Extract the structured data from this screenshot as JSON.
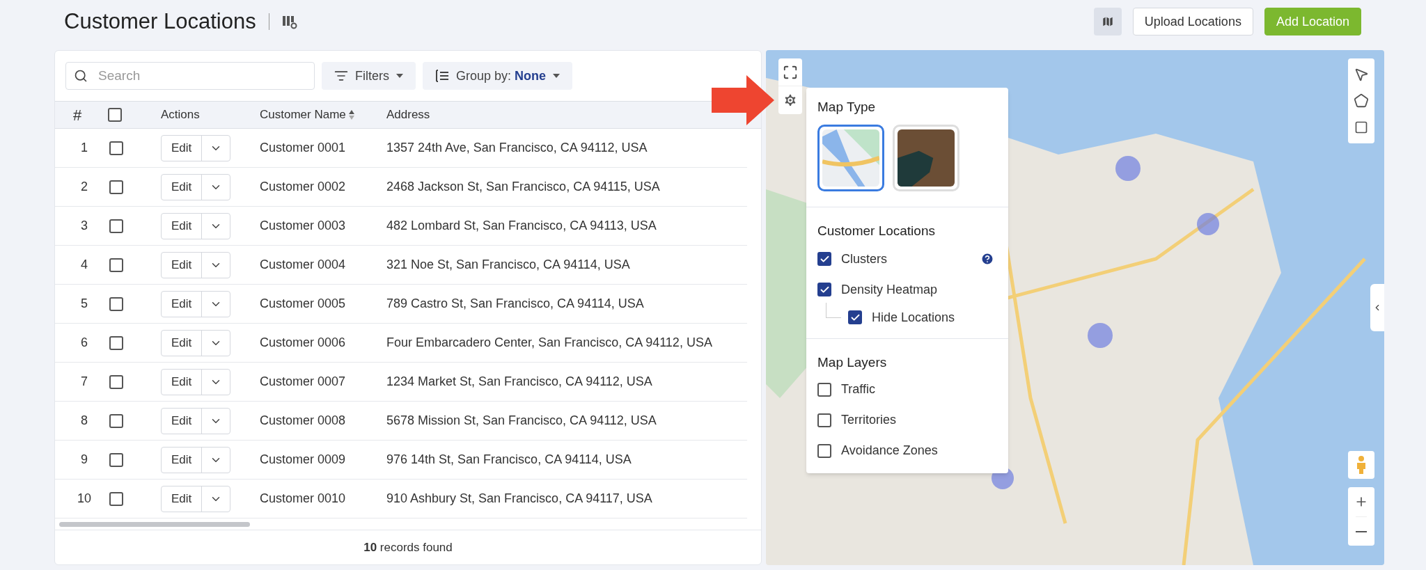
{
  "header": {
    "title": "Customer Locations",
    "buttons": [
      {
        "kind": "secondary",
        "label": "Upload Locations"
      },
      {
        "kind": "primary",
        "label": "Add Location"
      }
    ]
  },
  "toolbar": {
    "search": {
      "placeholder": "Search"
    },
    "filters": "Filters",
    "group_by": {
      "label": "Group by:",
      "value": "None"
    }
  },
  "table": {
    "columns": [
      "#",
      "Actions",
      "Customer Name",
      "Address"
    ],
    "select_all": {
      "checked": false
    },
    "rows": [
      {
        "index": "1",
        "checked": false,
        "action": "Edit",
        "name": "Customer 0001",
        "address": "1357 24th Ave, San Francisco, CA 94112, USA"
      },
      {
        "index": "2",
        "checked": false,
        "action": "Edit",
        "name": "Customer 0002",
        "address": "2468 Jackson St, San Francisco, CA 94115, USA"
      },
      {
        "index": "3",
        "checked": false,
        "action": "Edit",
        "name": "Customer 0003",
        "address": "482 Lombard St, San Francisco, CA 94113, USA"
      },
      {
        "index": "4",
        "checked": false,
        "action": "Edit",
        "name": "Customer 0004",
        "address": "321 Noe St, San Francisco, CA 94114, USA"
      },
      {
        "index": "5",
        "checked": false,
        "action": "Edit",
        "name": "Customer 0005",
        "address": "789 Castro St, San Francisco, CA 94114, USA"
      },
      {
        "index": "6",
        "checked": false,
        "action": "Edit",
        "name": "Customer 0006",
        "address": "Four Embarcadero Center, San Francisco, CA 94112, USA"
      },
      {
        "index": "7",
        "checked": false,
        "action": "Edit",
        "name": "Customer 0007",
        "address": "1234 Market St, San Francisco, CA 94112, USA"
      },
      {
        "index": "8",
        "checked": false,
        "action": "Edit",
        "name": "Customer 0008",
        "address": "5678 Mission St, San Francisco, CA 94112, USA"
      },
      {
        "index": "9",
        "checked": false,
        "action": "Edit",
        "name": "Customer 0009",
        "address": "976 14th St, San Francisco, CA 94114, USA"
      },
      {
        "index": "10",
        "checked": false,
        "action": "Edit",
        "name": "Customer 0010",
        "address": "910 Ashbury St, San Francisco, CA 94117, USA"
      }
    ],
    "footer": "**10** records found"
  },
  "map_settings": {
    "map_type": {
      "title": "Map Type",
      "types": [
        {
          "kind": "roadmap",
          "selected": true
        },
        {
          "kind": "satellite",
          "selected": false
        }
      ]
    },
    "customer_locations": {
      "title": "Customer Locations",
      "options": [
        {
          "label": "Clusters",
          "checked": true,
          "help": true
        },
        {
          "label": "Density Heatmap",
          "checked": true,
          "children": [
            {
              "label": "Hide Locations",
              "checked": true
            }
          ]
        }
      ]
    },
    "map_layers": {
      "title": "Map Layers",
      "options": [
        {
          "label": "Traffic",
          "checked": false
        },
        {
          "label": "Territories",
          "checked": false
        },
        {
          "label": "Avoidance Zones",
          "checked": false
        }
      ]
    }
  }
}
